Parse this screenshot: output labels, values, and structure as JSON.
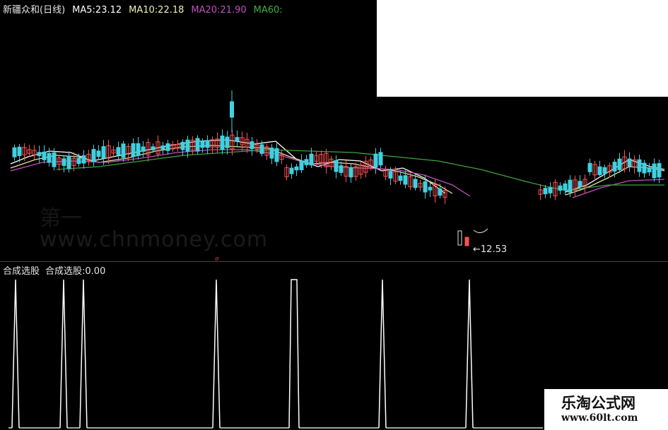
{
  "legend": {
    "name": "新疆众和(日线)",
    "ma5": "MA5:23.12",
    "ma10": "MA10:22.18",
    "ma20": "MA20:21.90",
    "ma60": "MA60:"
  },
  "colors": {
    "ma5": "#ffffff",
    "ma10": "#e6e6a0",
    "ma20": "#c050c0",
    "ma60": "#40a040",
    "up": "#ff5050",
    "down": "#40d0e0",
    "signal": "#ffffff"
  },
  "indicator": {
    "name": "合成选股",
    "value_label": "合成选股:0.00"
  },
  "low_price": "12.53",
  "watermark": {
    "text": "www.chnmoney.com",
    "cn": "第一"
  },
  "brand": {
    "cn": "乐淘公式网",
    "url": "www.60lt.com"
  }
}
